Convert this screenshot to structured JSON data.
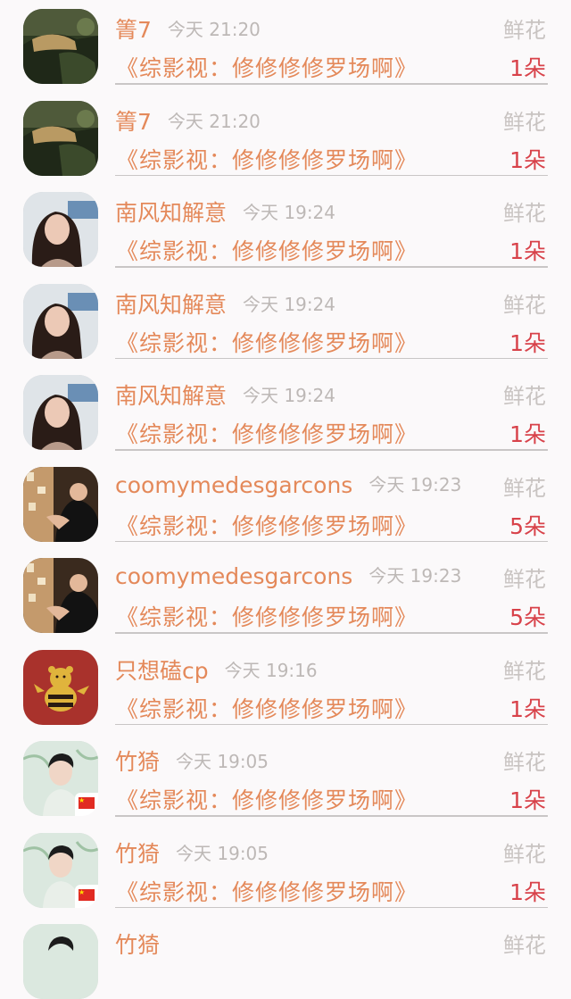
{
  "rows": [
    {
      "user": "箐7",
      "time": "今天 21:20",
      "gift": "鲜花",
      "book": "《综影视：修修修修罗场啊》",
      "qty": "1朵",
      "avatar": "painting-avatar"
    },
    {
      "user": "箐7",
      "time": "今天 21:20",
      "gift": "鲜花",
      "book": "《综影视：修修修修罗场啊》",
      "qty": "1朵",
      "avatar": "painting-avatar"
    },
    {
      "user": "南风知解意",
      "time": "今天 19:24",
      "gift": "鲜花",
      "book": "《综影视：修修修修罗场啊》",
      "qty": "1朵",
      "avatar": "girl-avatar"
    },
    {
      "user": "南风知解意",
      "time": "今天 19:24",
      "gift": "鲜花",
      "book": "《综影视：修修修修罗场啊》",
      "qty": "1朵",
      "avatar": "girl-avatar"
    },
    {
      "user": "南风知解意",
      "time": "今天 19:24",
      "gift": "鲜花",
      "book": "《综影视：修修修修罗场啊》",
      "qty": "1朵",
      "avatar": "girl-avatar"
    },
    {
      "user": "coomymedesgarcons",
      "time": "今天 19:23",
      "gift": "鲜花",
      "book": "《综影视：修修修修罗场啊》",
      "qty": "5朵",
      "avatar": "couple-avatar"
    },
    {
      "user": "coomymedesgarcons",
      "time": "今天 19:23",
      "gift": "鲜花",
      "book": "《综影视：修修修修罗场啊》",
      "qty": "5朵",
      "avatar": "couple-avatar"
    },
    {
      "user": "只想磕cp",
      "time": "今天 19:16",
      "gift": "鲜花",
      "book": "《综影视：修修修修罗场啊》",
      "qty": "1朵",
      "avatar": "bear-avatar"
    },
    {
      "user": "竹猗",
      "time": "今天 19:05",
      "gift": "鲜花",
      "book": "《综影视：修修修修罗场啊》",
      "qty": "1朵",
      "avatar": "boy-avatar"
    },
    {
      "user": "竹猗",
      "time": "今天 19:05",
      "gift": "鲜花",
      "book": "《综影视：修修修修罗场啊》",
      "qty": "1朵",
      "avatar": "boy-avatar"
    }
  ],
  "partial_row": {
    "user": "竹猗",
    "gift": "鲜花"
  },
  "colors": {
    "name": "#e4895a",
    "time": "#bdb8b6",
    "gift": "#c8c3c1",
    "qty": "#d8424a",
    "divider": "#c9c6c6"
  }
}
